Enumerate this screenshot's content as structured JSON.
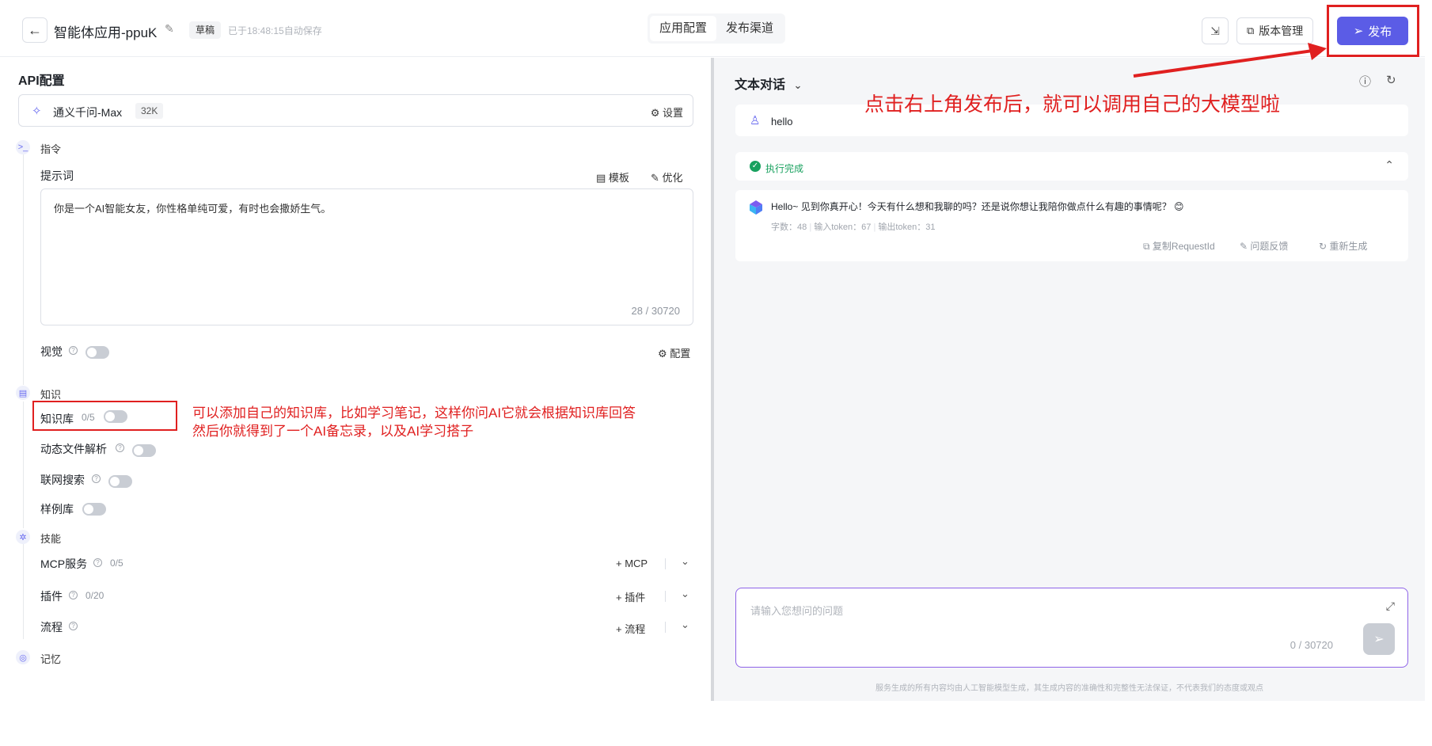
{
  "header": {
    "back_icon": "arrow-left-icon",
    "app_title": "智能体应用-ppuK",
    "draft_label": "草稿",
    "save_status": "已于18:48:15自动保存",
    "tabs": [
      {
        "label": "应用配置",
        "active": true
      },
      {
        "label": "发布渠道",
        "active": false
      }
    ],
    "version_label": "版本管理",
    "publish_label": "发布"
  },
  "left": {
    "api_title": "API配置",
    "model": {
      "name": "通义千问-Max",
      "context": "32K",
      "settings_label": "设置"
    },
    "instruction_group": "指令",
    "prompt_label": "提示词",
    "template_label": "模板",
    "optimize_label": "优化",
    "prompt_value": "你是一个AI智能女友，你性格单纯可爱，有时也会撒娇生气。",
    "prompt_count": "28 / 30720",
    "vision_label": "视觉",
    "vision_config_label": "配置",
    "knowledge_group": "知识",
    "kb_label": "知识库",
    "kb_count": "0/5",
    "dynamic_file_label": "动态文件解析",
    "web_search_label": "联网搜索",
    "example_label": "样例库",
    "skills_group": "技能",
    "mcp_label": "MCP服务",
    "mcp_count": "0/5",
    "mcp_add": "MCP",
    "plugin_label": "插件",
    "plugin_count": "0/20",
    "plugin_add": "插件",
    "flow_label": "流程",
    "flow_add": "流程",
    "memory_group": "记忆"
  },
  "annotations": {
    "top": "点击右上角发布后，就可以调用自己的大模型啦",
    "kb_line1": "可以添加自己的知识库，比如学习笔记，这样你问AI它就会根据知识库回答",
    "kb_line2": "然后你就得到了一个AI备忘录，以及AI学习搭子",
    "color": "#e02020"
  },
  "right": {
    "chat_title": "文本对话",
    "user_message": "hello",
    "status": "执行完成",
    "bot_message": "Hello~ 见到你真开心！今天有什么想和我聊的吗？还是说你想让我陪你做点什么有趣的事情呢？ 😊",
    "stats": {
      "chars": "字数：48",
      "input_tokens": "输入token：67",
      "output_tokens": "输出token：31"
    },
    "actions": {
      "copy": "复制RequestId",
      "feedback": "问题反馈",
      "regenerate": "重新生成"
    },
    "input_placeholder": "请输入您想问的问题",
    "input_count": "0 / 30720",
    "disclaimer": "服务生成的所有内容均由人工智能模型生成，其生成内容的准确性和完整性无法保证，不代表我们的态度或观点"
  },
  "colors": {
    "accent": "#5b5ce6",
    "success": "#19a15f",
    "annotation": "#e02020",
    "input_border": "#8e63e8"
  }
}
